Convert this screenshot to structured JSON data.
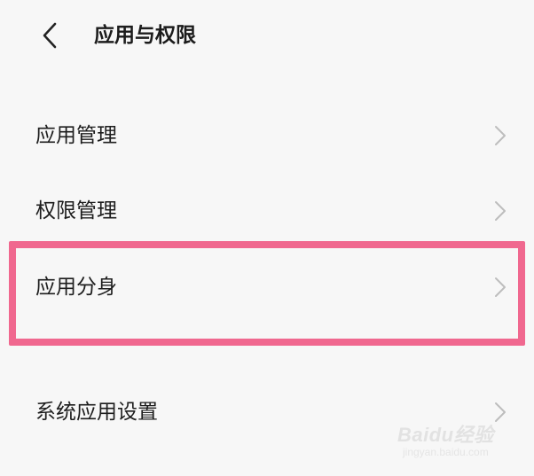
{
  "header": {
    "back_icon": "chevron-left-icon",
    "title": "应用与权限"
  },
  "menu": {
    "items": [
      {
        "label": "应用管理",
        "icon": "chevron-right-icon",
        "highlighted": false
      },
      {
        "label": "权限管理",
        "icon": "chevron-right-icon",
        "highlighted": false
      },
      {
        "label": "应用分身",
        "icon": "chevron-right-icon",
        "highlighted": true
      },
      {
        "label": "系统应用设置",
        "icon": "chevron-right-icon",
        "highlighted": false
      }
    ]
  },
  "watermark": {
    "brand": "Baidu经验",
    "url": "jingyan.baidu.com"
  },
  "colors": {
    "background": "#f7f7f7",
    "highlight_border": "#f0688f",
    "chevron": "#bdbdbd"
  }
}
